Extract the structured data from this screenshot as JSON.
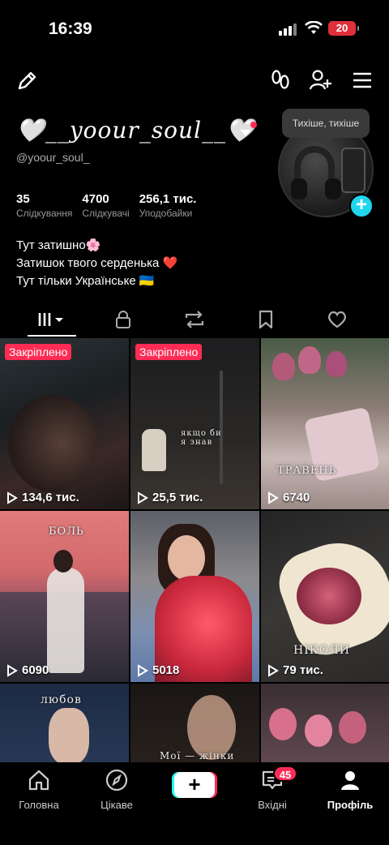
{
  "status_bar": {
    "time": "16:39",
    "battery": "20"
  },
  "profile": {
    "display_name": "🤍__yoour_soul__🤍",
    "handle": "@yoour_soul_",
    "note_bubble": "Тихіше, тихіше",
    "stats": [
      {
        "value": "35",
        "label": "Слідкування"
      },
      {
        "value": "4700",
        "label": "Слідкувачі"
      },
      {
        "value": "256,1 тис.",
        "label": "Уподобайки"
      }
    ],
    "bio": [
      "Тут затишно🌸",
      " Затишок твого серденька ❤️",
      "Тут тільки Українське 🇺🇦"
    ]
  },
  "grid": {
    "pinned_label": "Закріплено",
    "tiles": [
      {
        "views": "134,6 тис.",
        "pinned": true,
        "caption": ""
      },
      {
        "views": "25,5 тис.",
        "pinned": true,
        "caption": "якщо би я знав"
      },
      {
        "views": "6740",
        "pinned": false,
        "caption": "ТРАВЕНЬ"
      },
      {
        "views": "6090",
        "pinned": false,
        "caption": "БОЛЬ"
      },
      {
        "views": "5018",
        "pinned": false,
        "caption": ""
      },
      {
        "views": "79 тис.",
        "pinned": false,
        "caption": "НІКОЛИ"
      },
      {
        "views": "",
        "pinned": false,
        "caption": "любов"
      },
      {
        "views": "",
        "pinned": false,
        "caption": "Мої — жінки"
      },
      {
        "views": "",
        "pinned": false,
        "caption": ""
      }
    ]
  },
  "bottom_nav": {
    "items": [
      {
        "label": "Головна",
        "icon": "home-icon"
      },
      {
        "label": "Цікаве",
        "icon": "compass-icon"
      },
      {
        "label": "",
        "icon": "create-plus-icon"
      },
      {
        "label": "Вхідні",
        "icon": "inbox-icon"
      },
      {
        "label": "Профіль",
        "icon": "profile-icon"
      }
    ],
    "inbox_badge": "45"
  },
  "colors": {
    "accent": "#fe2c55",
    "cyan": "#25f4ee",
    "plus": "#20d5ec"
  }
}
